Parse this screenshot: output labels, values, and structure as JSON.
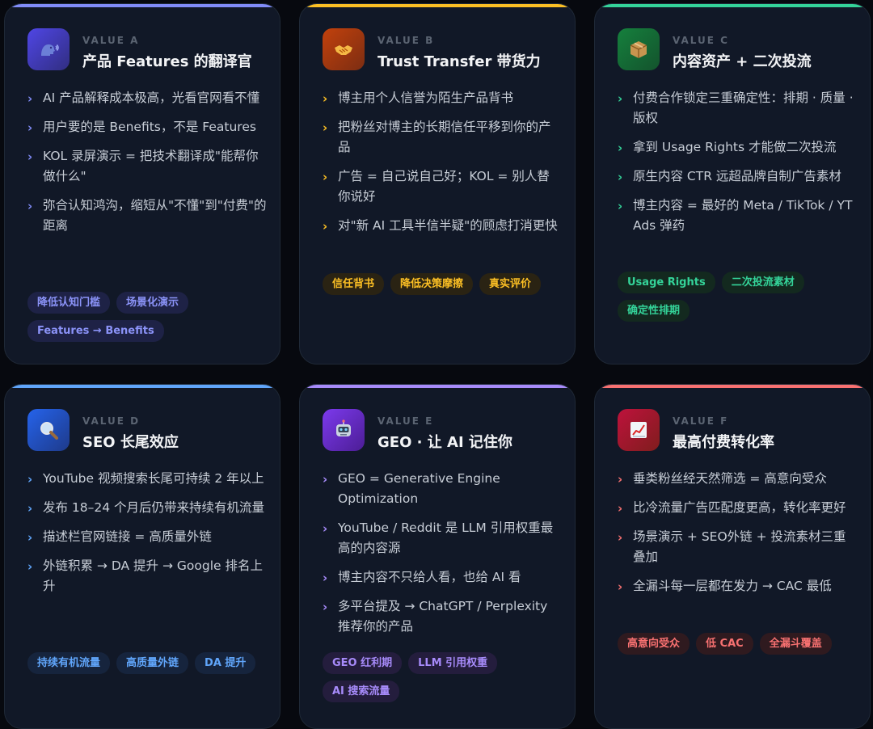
{
  "cards": [
    {
      "label": "VALUE A",
      "title": "产品 Features 的翻译官",
      "icon": "speaking-head-icon",
      "accent": "#818cf8",
      "tag_bg": "#1e2246",
      "tag_color": "#8b93f8",
      "bullets": [
        "AI 产品解释成本极高，光看官网看不懂",
        "用户要的是 Benefits，不是 Features",
        "KOL 录屏演示 = 把技术翻译成\"能帮你做什么\"",
        "弥合认知鸿沟，缩短从\"不懂\"到\"付费\"的距离"
      ],
      "tags": [
        "降低认知门槛",
        "场景化演示",
        "Features → Benefits"
      ]
    },
    {
      "label": "VALUE B",
      "title": "Trust Transfer 带货力",
      "icon": "handshake-icon",
      "accent": "#fbbf24",
      "tag_bg": "#2a2313",
      "tag_color": "#fbbf24",
      "bullets": [
        "博主用个人信誉为陌生产品背书",
        "把粉丝对博主的长期信任平移到你的产品",
        "广告 = 自己说自己好；KOL = 别人替你说好",
        "对\"新 AI 工具半信半疑\"的顾虑打消更快"
      ],
      "tags": [
        "信任背书",
        "降低决策摩擦",
        "真实评价"
      ]
    },
    {
      "label": "VALUE C",
      "title": "内容资产 + 二次投流",
      "icon": "package-icon",
      "accent": "#34d399",
      "tag_bg": "#13291f",
      "tag_color": "#34d399",
      "bullets": [
        "付费合作锁定三重确定性：排期 · 质量 · 版权",
        "拿到 Usage Rights 才能做二次投流",
        "原生内容 CTR 远超品牌自制广告素材",
        "博主内容 = 最好的 Meta / TikTok / YT Ads 弹药"
      ],
      "tags": [
        "Usage Rights",
        "二次投流素材",
        "确定性排期"
      ]
    },
    {
      "label": "VALUE D",
      "title": "SEO 长尾效应",
      "icon": "magnifying-glass-icon",
      "accent": "#60a5fa",
      "tag_bg": "#16243d",
      "tag_color": "#60a5fa",
      "bullets": [
        "YouTube 视频搜索长尾可持续 2 年以上",
        "发布 18–24 个月后仍带来持续有机流量",
        "描述栏官网链接 = 高质量外链",
        "外链积累 → DA 提升 → Google 排名上升"
      ],
      "tags": [
        "持续有机流量",
        "高质量外链",
        "DA 提升"
      ]
    },
    {
      "label": "VALUE E",
      "title": "GEO · 让 AI 记住你",
      "icon": "robot-icon",
      "accent": "#a78bfa",
      "tag_bg": "#241d3d",
      "tag_color": "#a78bfa",
      "bullets": [
        "GEO = Generative Engine Optimization",
        "YouTube / Reddit 是 LLM 引用权重最高的内容源",
        "博主内容不只给人看，也给 AI 看",
        "多平台提及 → ChatGPT / Perplexity 推荐你的产品"
      ],
      "tags": [
        "GEO 红利期",
        "LLM 引用权重",
        "AI 搜索流量"
      ]
    },
    {
      "label": "VALUE F",
      "title": "最高付费转化率",
      "icon": "chart-increasing-icon",
      "accent": "#f87171",
      "tag_bg": "#2f1a1f",
      "tag_color": "#f87171",
      "bullets": [
        "垂类粉丝经天然筛选 = 高意向受众",
        "比冷流量广告匹配度更高，转化率更好",
        "场景演示 + SEO外链 + 投流素材三重叠加",
        "全漏斗每一层都在发力 → CAC 最低"
      ],
      "tags": [
        "高意向受众",
        "低 CAC",
        "全漏斗覆盖"
      ]
    }
  ]
}
